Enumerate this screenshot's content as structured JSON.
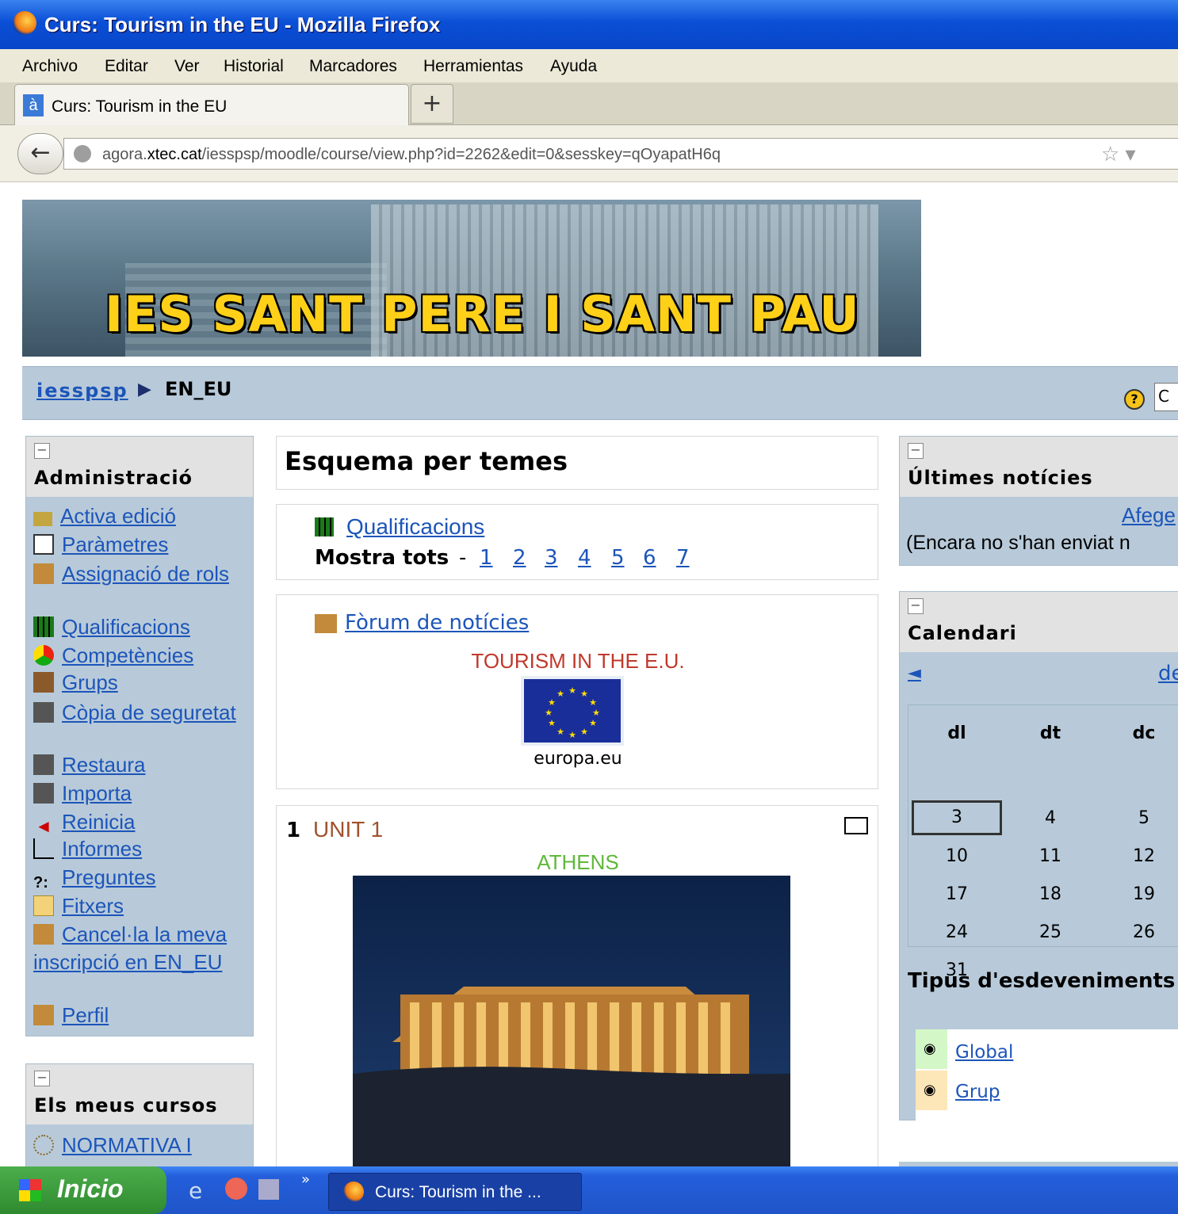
{
  "window": {
    "title": "Curs: Tourism in the EU - Mozilla Firefox"
  },
  "menu": [
    "Archivo",
    "Editar",
    "Ver",
    "Historial",
    "Marcadores",
    "Herramientas",
    "Ayuda"
  ],
  "tab": {
    "label": "Curs: Tourism in the EU",
    "newtab": "+"
  },
  "nav": {
    "url_pre": "agora.",
    "url_host": "xtec.cat",
    "url_post": "/iesspsp/moodle/course/view.php?id=2262&edit=0&sesskey=qOyapatH6q"
  },
  "banner": {
    "title": "IES SANT PERE I SANT PAU"
  },
  "breadcrumb": {
    "home": "iesspsp",
    "sep": "▶",
    "current": "EN_EU",
    "select": "C"
  },
  "admin": {
    "title": "Administració",
    "items": [
      "Activa edició",
      "Paràmetres",
      "Assignació de rols",
      "Qualificacions",
      "Competències",
      "Grups",
      "Còpia de seguretat",
      "Restaura",
      "Importa",
      "Reinicia",
      "Informes",
      "Preguntes",
      "Fitxers",
      "Cancel·la la meva inscripció en EN_EU",
      "Perfil"
    ]
  },
  "mycourses": {
    "title": "Els meus cursos",
    "items": [
      "NORMATIVA I"
    ]
  },
  "main": {
    "title": "Esquema per temes",
    "grades_link": "Qualificacions",
    "show_all": "Mostra tots",
    "dash": "-",
    "pages": [
      "1",
      "2",
      "3",
      "4",
      "5",
      "6",
      "7"
    ],
    "forum_link": "Fòrum de notícies",
    "tourism": "TOURISM IN THE E.U.",
    "europa": "europa.eu",
    "unit_num": "1",
    "unit_title": "UNIT 1",
    "athens": "ATHENS"
  },
  "news": {
    "title": "Últimes notícies",
    "add": "Afege",
    "empty": "(Encara no s'han enviat n"
  },
  "calendar": {
    "title": "Calendari",
    "prev": "◄",
    "next": "de",
    "days": [
      "dl",
      "dt",
      "dc"
    ],
    "rows": [
      [
        "3",
        "4",
        "5"
      ],
      [
        "10",
        "11",
        "12"
      ],
      [
        "17",
        "18",
        "19"
      ],
      [
        "24",
        "25",
        "26"
      ],
      [
        "31",
        "",
        ""
      ]
    ],
    "events_title": "Tipus d'esdeveniments",
    "events": [
      "Global",
      "Grup"
    ]
  },
  "taskbar": {
    "start": "Inicio",
    "task": "Curs: Tourism in the ...",
    "chevron": "»"
  },
  "colors": {
    "accent": "#1c55ba",
    "unit": "#a0522d",
    "tourism": "#c0392b",
    "athens": "#5fb83a"
  }
}
